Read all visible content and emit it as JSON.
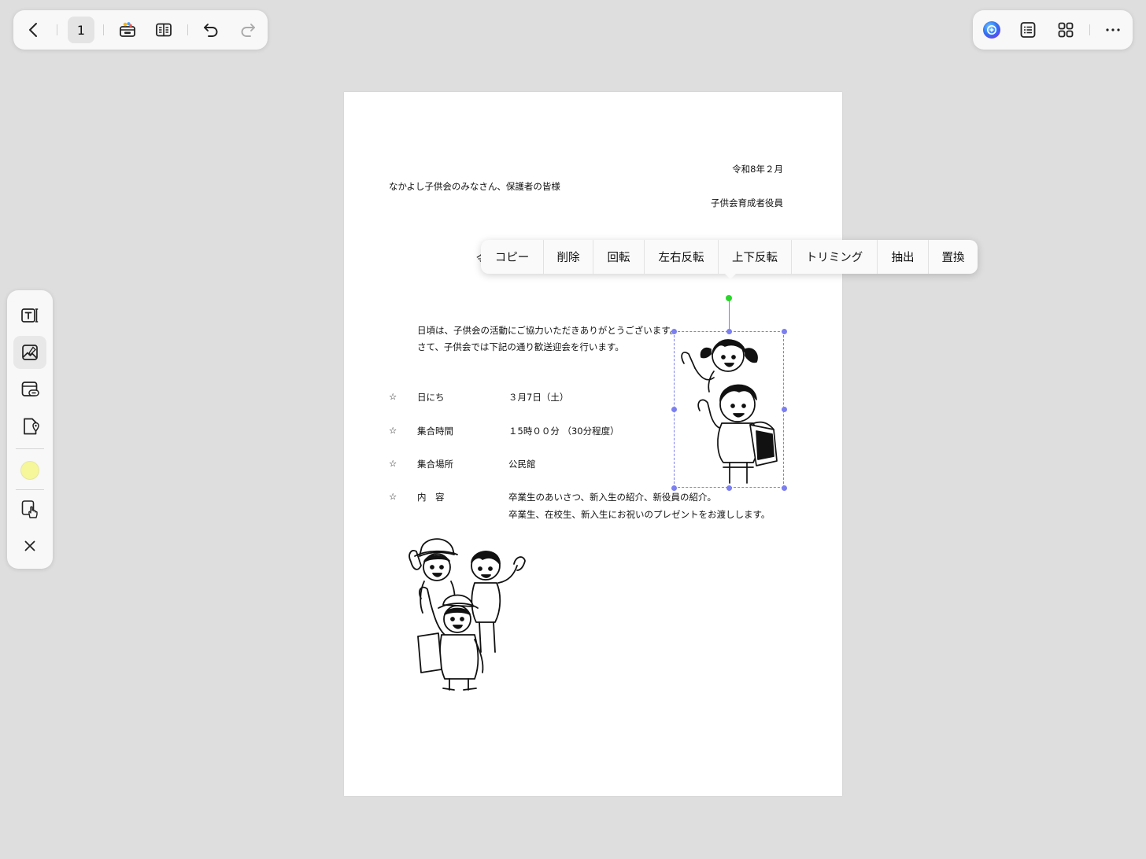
{
  "toolbar": {
    "page_number": "1"
  },
  "document": {
    "date": "令和8年２月",
    "addressee": "なかよし子供会のみなさん、保護者の皆様",
    "sender": "子供会育成者役員",
    "title_partial": "令",
    "body_line1": "日頃は、子供会の活動にご協力いただきありがとうございます。",
    "body_line2": "さて、子供会では下記の通り歓送迎会を行います。",
    "items": [
      {
        "mark": "☆",
        "label": "日にち",
        "value": "３月7日（土）"
      },
      {
        "mark": "☆",
        "label": "集合時間",
        "value": "１5時００分 （30分程度）"
      },
      {
        "mark": "☆",
        "label": "集合場所",
        "value": "公民館"
      },
      {
        "mark": "☆",
        "label": "内　容",
        "value": "卒業生のあいさつ、新入生の紹介、新役員の紹介。"
      }
    ],
    "content_line2": "卒業生、在校生、新入生にお祝いのプレゼントをお渡しします。"
  },
  "context_menu": {
    "items": [
      "コピー",
      "削除",
      "回転",
      "左右反転",
      "上下反転",
      "トリミング",
      "抽出",
      "置換"
    ]
  },
  "colors": {
    "selection": "#7b7ff0",
    "rotate_handle": "#2bd62b",
    "highlight_swatch": "#f6f79a"
  }
}
